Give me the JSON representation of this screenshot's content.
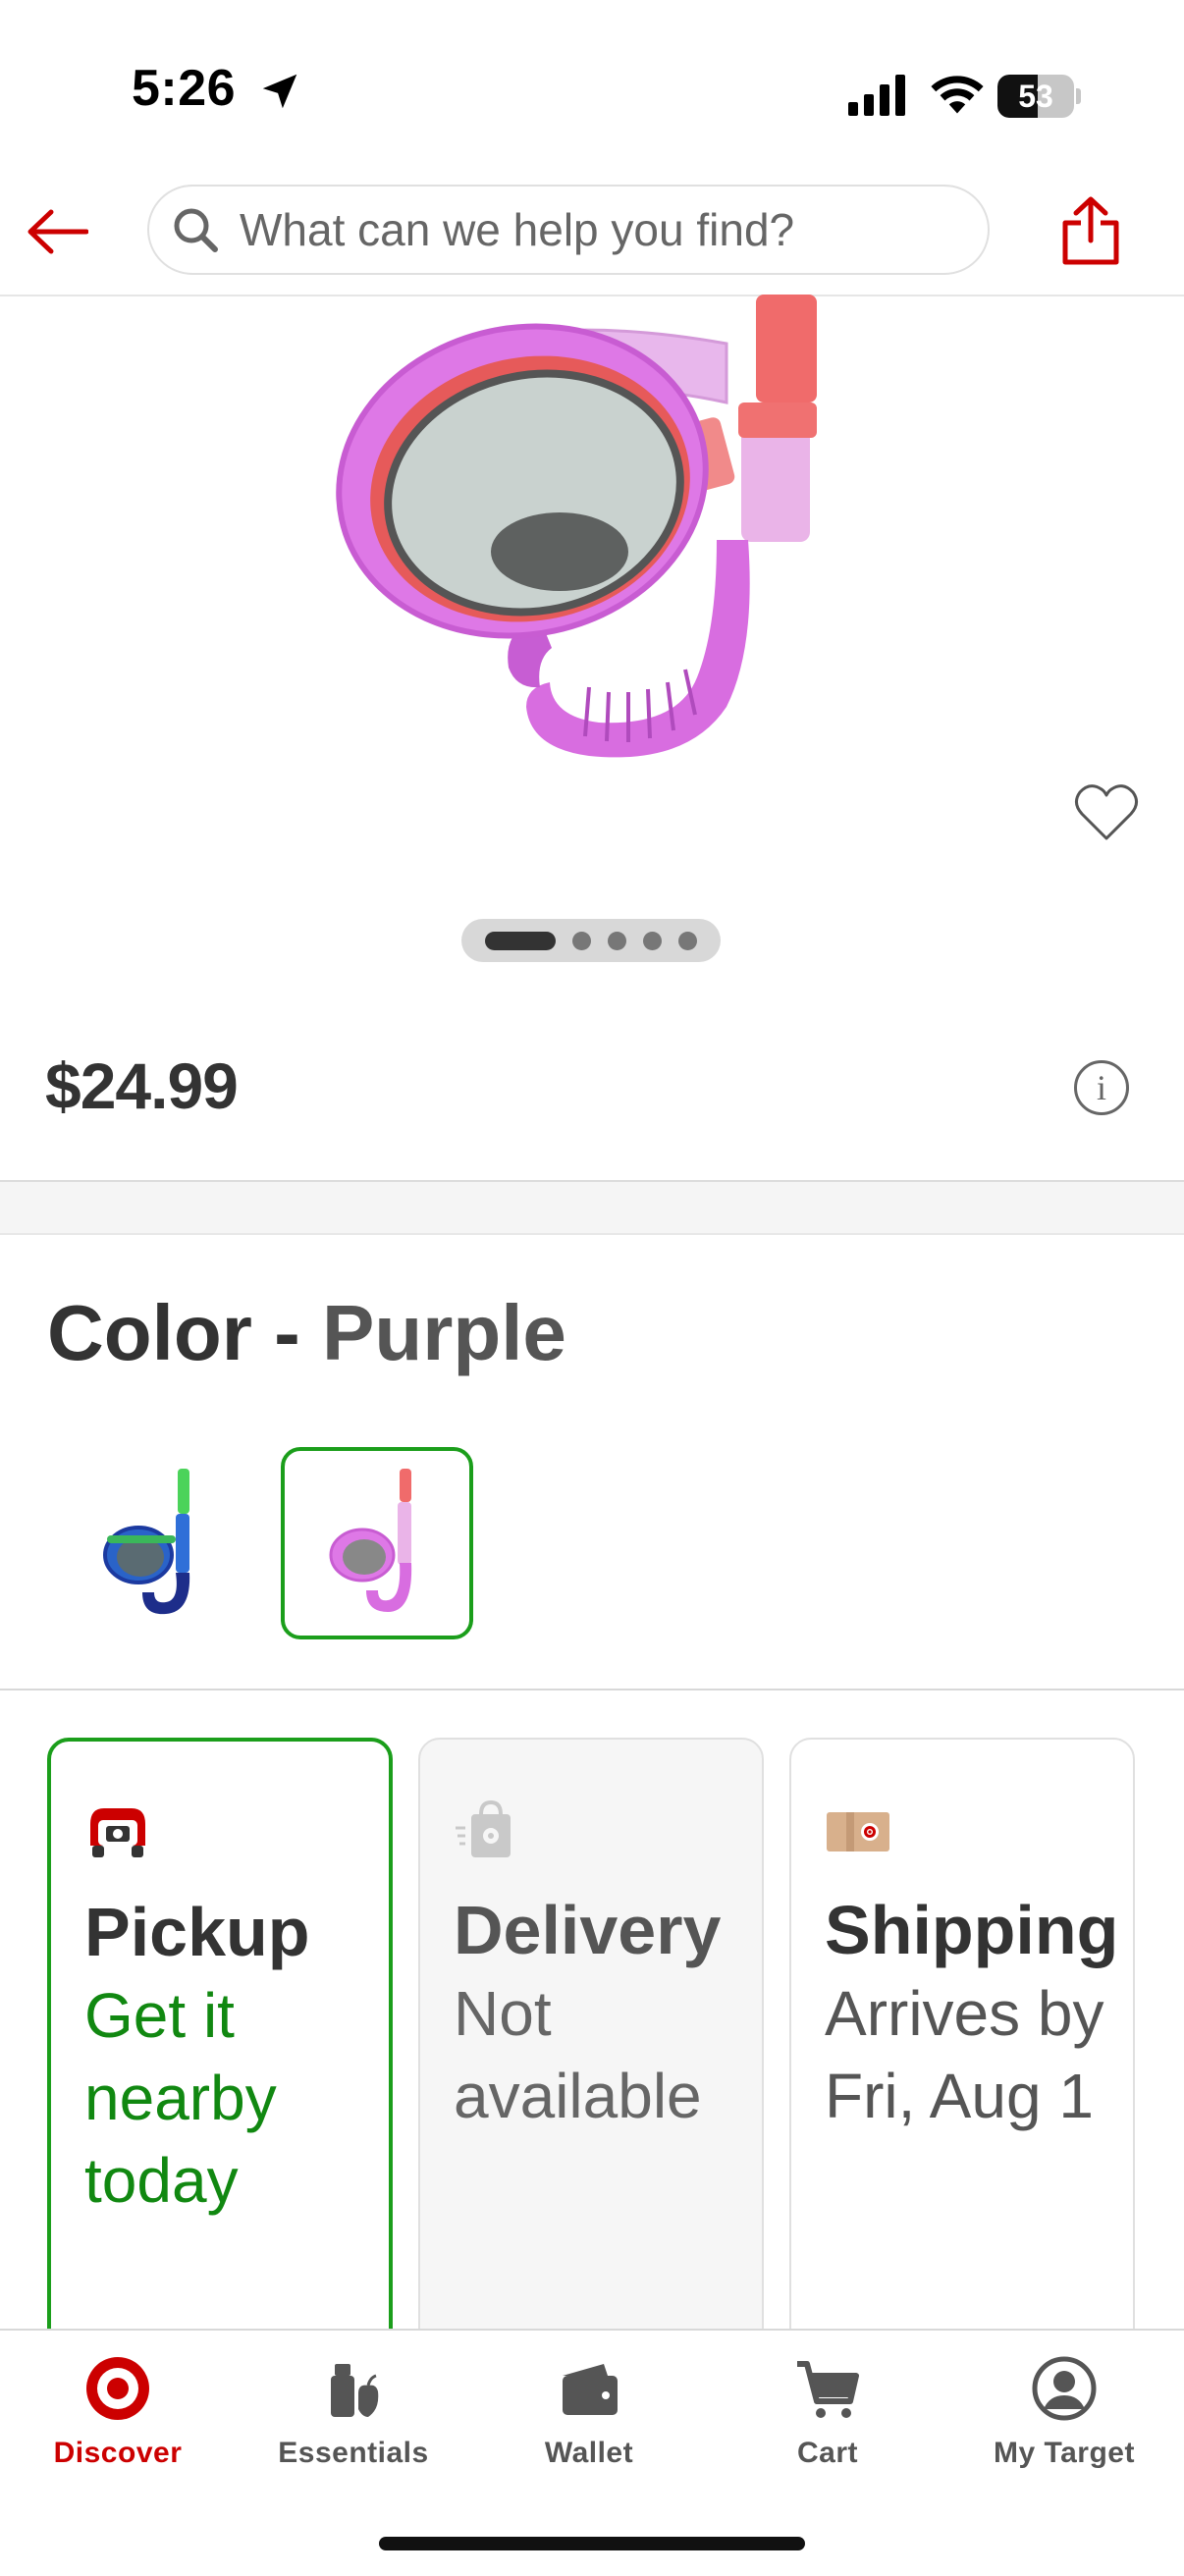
{
  "status_bar": {
    "time": "5:26",
    "battery": "53",
    "battery_level": 0.53
  },
  "header": {
    "search_placeholder": "What can we help you find?",
    "icons": [
      "back-arrow-icon",
      "search-icon",
      "share-icon"
    ]
  },
  "product": {
    "image": "purple snorkel set",
    "carousel": {
      "total": 5,
      "active": 1
    },
    "price": "$24.99"
  },
  "color": {
    "label": "Color",
    "separator": " - ",
    "selected": "Purple",
    "swatches": [
      {
        "name": "blue-green snorkel set",
        "selected": false
      },
      {
        "name": "purple snorkel set",
        "selected": true
      }
    ]
  },
  "fulfillment": {
    "pickup": {
      "title": "Pickup",
      "status": "Get it nearby today",
      "selected": true
    },
    "delivery": {
      "title": "Delivery",
      "status": "Not available",
      "selected": false
    },
    "shipping": {
      "title": "Shipping",
      "status": "Arrives by Fri, Aug 1",
      "selected": false
    }
  },
  "bottom_nav": {
    "items": [
      {
        "label": "Discover",
        "icon": "target-bullseye-icon",
        "active": true
      },
      {
        "label": "Essentials",
        "icon": "essentials-icon",
        "active": false
      },
      {
        "label": "Wallet",
        "icon": "wallet-icon",
        "active": false
      },
      {
        "label": "Cart",
        "icon": "cart-icon",
        "active": false
      },
      {
        "label": "My Target",
        "icon": "account-icon",
        "active": false
      }
    ]
  },
  "colors": {
    "brand": "#cc0000",
    "selected_green": "#1b9e1b",
    "text": "#333333"
  }
}
